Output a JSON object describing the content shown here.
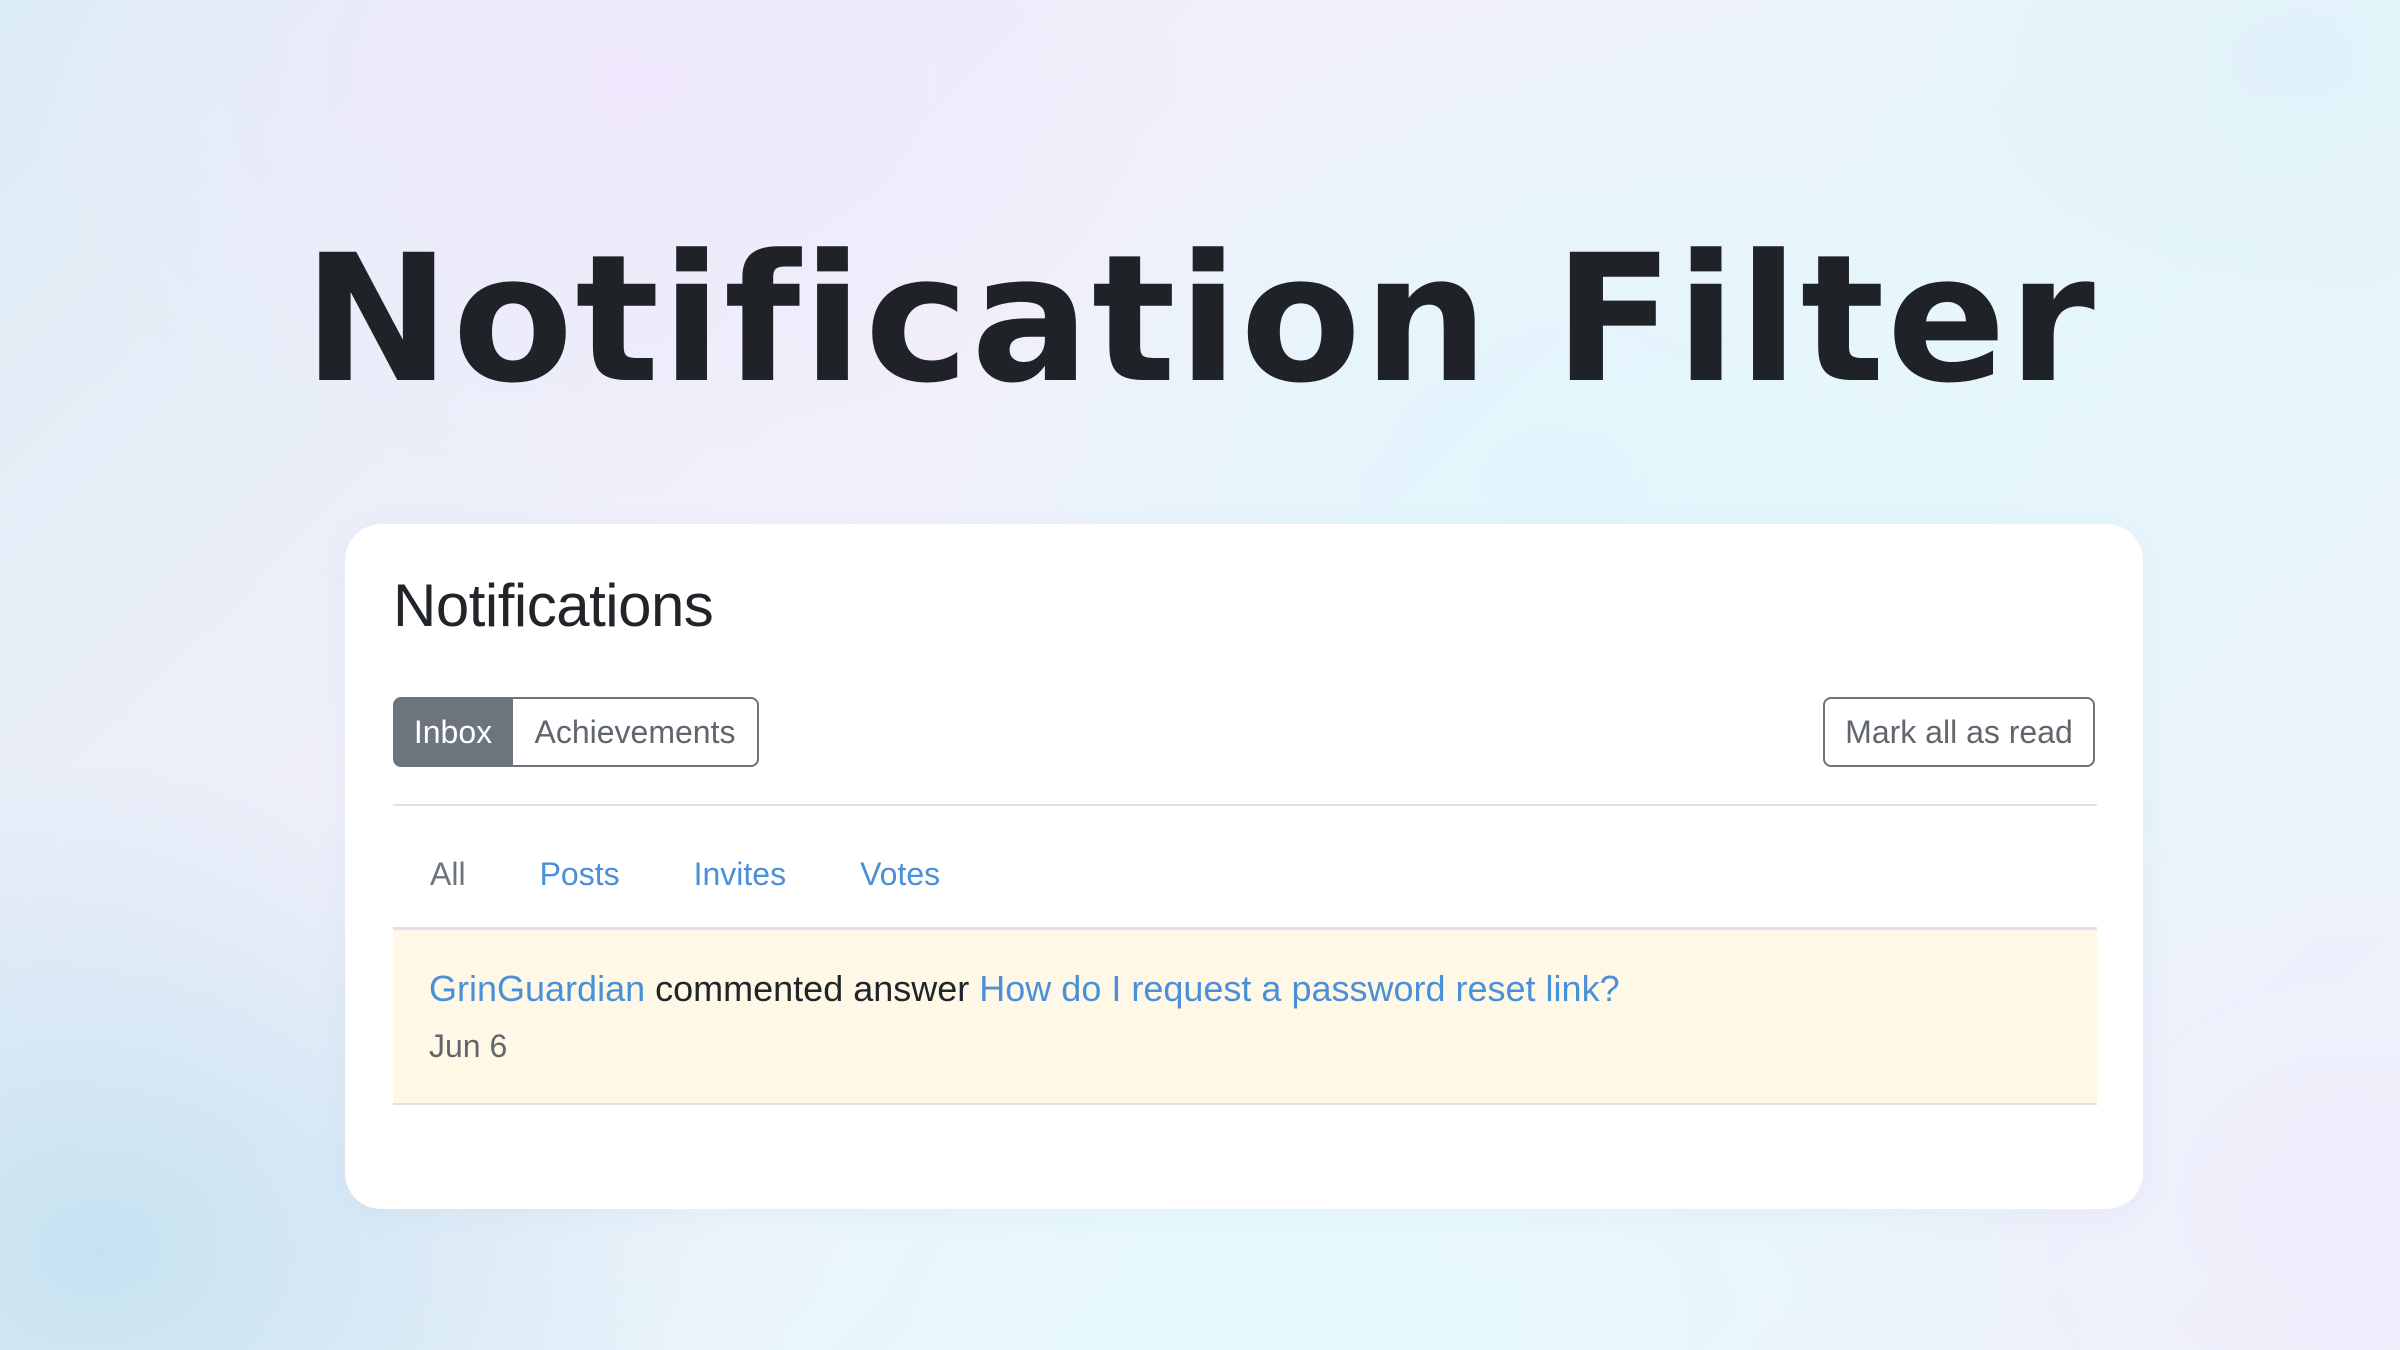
{
  "hero": {
    "title": "Notification Filter"
  },
  "panel": {
    "title": "Notifications",
    "tabs": {
      "inbox": "Inbox",
      "achievements": "Achievements"
    },
    "mark_all_label": "Mark all as read",
    "filters": [
      "All",
      "Posts",
      "Invites",
      "Votes"
    ],
    "active_filter": "All"
  },
  "notifications": [
    {
      "user": "GrinGuardian",
      "action": "commented answer",
      "question": "How do I request a password reset link?",
      "date": "Jun 6"
    }
  ],
  "colors": {
    "link": "#4a90d9",
    "secondary": "#6c757d",
    "unread_background": "#fff8e7",
    "text": "#212529"
  }
}
